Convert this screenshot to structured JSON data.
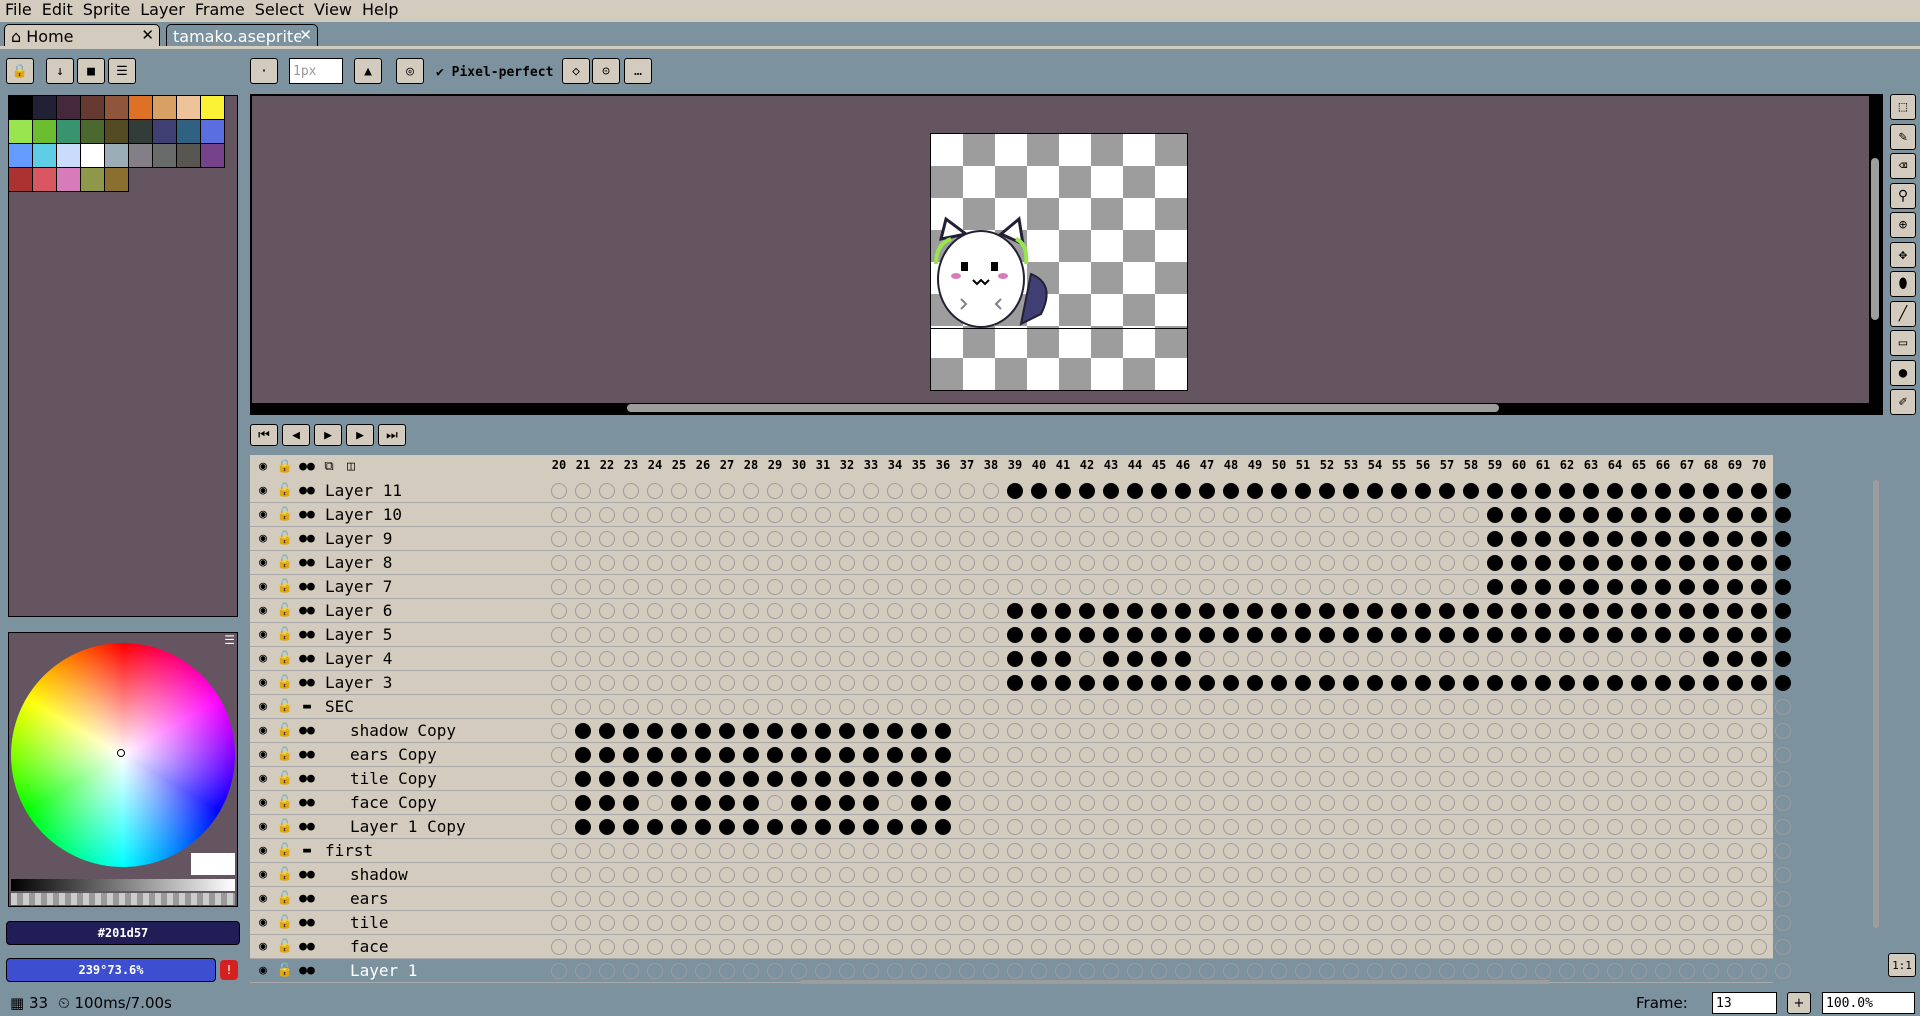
{
  "menu": [
    "File",
    "Edit",
    "Sprite",
    "Layer",
    "Frame",
    "Select",
    "View",
    "Help"
  ],
  "tabs": {
    "home": "Home",
    "file": "tamako.aseprite"
  },
  "toolbar": {
    "brush_size": "1px",
    "pixel_perfect": "Pixel-perfect"
  },
  "palette": [
    "#000000",
    "#222034",
    "#45283c",
    "#663931",
    "#8f563b",
    "#df7126",
    "#d9a066",
    "#eec39a",
    "#fbf236",
    "#99e550",
    "#6abe30",
    "#37946e",
    "#4b692f",
    "#524b24",
    "#323c39",
    "#3f3f74",
    "#306082",
    "#5b6ee1",
    "#639bff",
    "#5fcde4",
    "#cbdbfc",
    "#ffffff",
    "#9badb7",
    "#847e87",
    "#696a6a",
    "#595652",
    "#76428a",
    "#ac3232",
    "#d95763",
    "#d77bba",
    "#8f974a",
    "#8a6f30"
  ],
  "colors": {
    "fg": "#201d57",
    "bg": "#ffffff",
    "accent": "#5b6ee1"
  },
  "fg_color_hex": "#201d57",
  "fg_color_hsv": "239°73.6%",
  "timeline": {
    "frames": [
      "20",
      "21",
      "22",
      "23",
      "24",
      "25",
      "26",
      "27",
      "28",
      "29",
      "30",
      "31",
      "32",
      "33",
      "34",
      "35",
      "36",
      "37",
      "38",
      "39",
      "40",
      "41",
      "42",
      "43",
      "44",
      "45",
      "46",
      "47",
      "48",
      "49",
      "50",
      "51",
      "52",
      "53",
      "54",
      "55",
      "56",
      "57",
      "58",
      "59",
      "60",
      "61",
      "62",
      "63",
      "64",
      "65",
      "66",
      "67",
      "68",
      "69",
      "70"
    ],
    "layers": [
      {
        "name": "Layer 11",
        "indent": 0,
        "group": false,
        "cels": "0000000000000000000111111111111111111111111111111111"
      },
      {
        "name": "Layer 10",
        "indent": 0,
        "group": false,
        "cels": "0000000000000000000000000000000000000001111111111111"
      },
      {
        "name": "Layer 9",
        "indent": 0,
        "group": false,
        "cels": "0000000000000000000000000000000000000001111111111111"
      },
      {
        "name": "Layer 8",
        "indent": 0,
        "group": false,
        "cels": "0000000000000000000000000000000000000001111111111111"
      },
      {
        "name": "Layer 7",
        "indent": 0,
        "group": false,
        "cels": "0000000000000000000000000000000000000001111111111111"
      },
      {
        "name": "Layer 6",
        "indent": 0,
        "group": false,
        "cels": "0000000000000000000111111111111111111111111111111111"
      },
      {
        "name": "Layer 5",
        "indent": 0,
        "group": false,
        "cels": "0000000000000000000111111111111111111111111111111111"
      },
      {
        "name": "Layer 4",
        "indent": 0,
        "group": false,
        "cels": "0000000000000000000111011110000000000000000000001111"
      },
      {
        "name": "Layer 3",
        "indent": 0,
        "group": false,
        "cels": "0000000000000000000111111111111111111111111111111111"
      },
      {
        "name": "SEC",
        "indent": 0,
        "group": true,
        "cels": "0000000000000000000000000000000000000000000000000000"
      },
      {
        "name": "shadow Copy",
        "indent": 1,
        "group": false,
        "cels": "0111111111111111100000000000000000000000000000000000"
      },
      {
        "name": "ears Copy",
        "indent": 1,
        "group": false,
        "cels": "0111111111111111100000000000000000000000000000000000"
      },
      {
        "name": "tile Copy",
        "indent": 1,
        "group": false,
        "cels": "0111111111111111100000000000000000000000000000000000"
      },
      {
        "name": "face Copy",
        "indent": 1,
        "group": false,
        "cels": "0111011110111101100000000000000000000000000000000000"
      },
      {
        "name": "Layer 1 Copy",
        "indent": 1,
        "group": false,
        "cels": "0111111111111111100000000000000000000000000000000000"
      },
      {
        "name": "first",
        "indent": 0,
        "group": true,
        "cels": "0000000000000000000000000000000000000000000000000000"
      },
      {
        "name": "shadow",
        "indent": 1,
        "group": false,
        "cels": "0000000000000000000000000000000000000000000000000000"
      },
      {
        "name": "ears",
        "indent": 1,
        "group": false,
        "cels": "0000000000000000000000000000000000000000000000000000"
      },
      {
        "name": "tile",
        "indent": 1,
        "group": false,
        "cels": "0000000000000000000000000000000000000000000000000000"
      },
      {
        "name": "face",
        "indent": 1,
        "group": false,
        "cels": "0000000000000000000000000000000000000000000000000000"
      },
      {
        "name": "Layer 1",
        "indent": 1,
        "group": false,
        "selected": true,
        "cels": "0000000000000000000000000000000000000000000000000000"
      }
    ]
  },
  "status": {
    "frame_count": "33",
    "duration": "100ms/7.00s",
    "frame_label": "Frame:",
    "frame_value": "13",
    "zoom": "100.0%"
  }
}
